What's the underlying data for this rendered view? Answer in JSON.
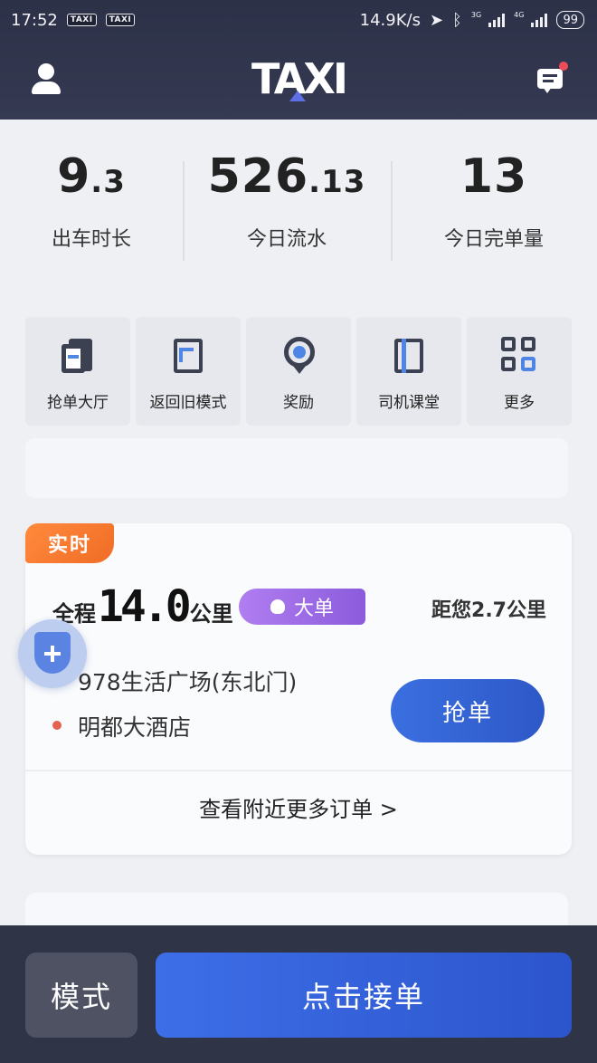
{
  "status_bar": {
    "time": "17:52",
    "badge_1": "TAXI",
    "badge_2": "TAXI",
    "net_speed": "14.9K/s",
    "sig1_label": "3G",
    "sig2_label": "4G",
    "battery": "99"
  },
  "header": {
    "logo": "TAXI",
    "user_icon": "user-icon",
    "message_icon": "message-icon"
  },
  "stats": [
    {
      "int": "9",
      "dec": ".3",
      "label": "出车时长"
    },
    {
      "int": "526",
      "dec": ".13",
      "label": "今日流水"
    },
    {
      "int": "13",
      "dec": "",
      "label": "今日完单量"
    }
  ],
  "actions": [
    {
      "label": "抢单大厅",
      "icon": "order-hall-icon"
    },
    {
      "label": "返回旧模式",
      "icon": "return-icon"
    },
    {
      "label": "奖励",
      "icon": "reward-icon"
    },
    {
      "label": "司机课堂",
      "icon": "book-icon"
    },
    {
      "label": "更多",
      "icon": "grid-icon"
    }
  ],
  "order": {
    "tag": "实时",
    "trip_prefix": "全程",
    "trip_km": "14.0",
    "trip_unit": "公里",
    "badge": "大单",
    "distance": "距您2.7公里",
    "from": "978生活广场(东北门)",
    "to": "明都大酒店",
    "grab_button": "抢单",
    "more_link": "查看附近更多订单 >"
  },
  "colors": {
    "header_bg": "#2c3148",
    "accent_blue": "#3b6fe0",
    "tag_orange": "#f06c26",
    "badge_purple": "#8b5bdc",
    "from_dot": "#9aa0aa",
    "to_dot": "#e5614f"
  },
  "bottom": {
    "mode_button": "模式",
    "accept_button": "点击接单"
  }
}
